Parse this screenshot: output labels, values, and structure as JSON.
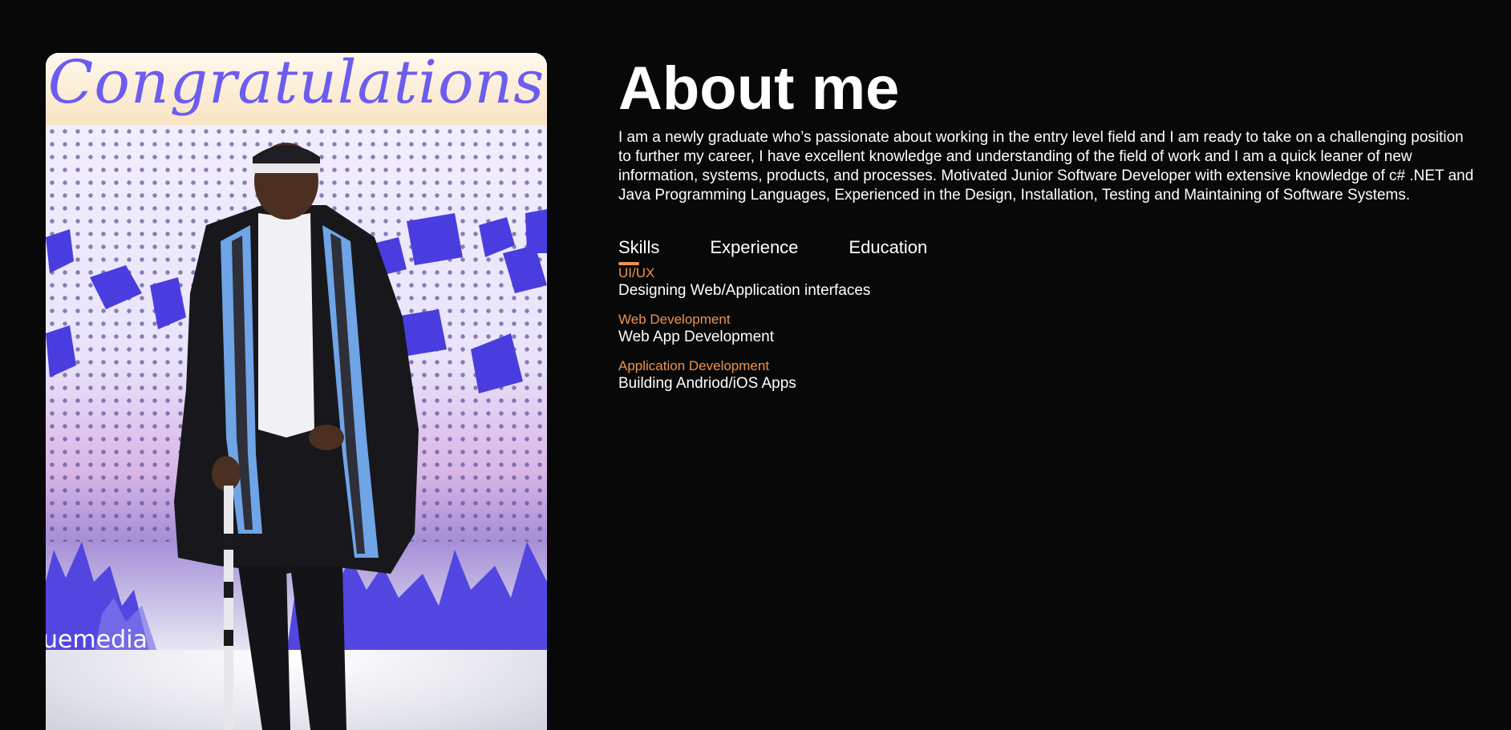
{
  "photo": {
    "banner_text": "Congratulations",
    "brand_text": "uemedia",
    "alt": "Graduation portrait"
  },
  "about": {
    "title": "About me",
    "bio": "I am a newly graduate who’s passionate about working in the entry level field and I am ready to take on a challenging position to further my career, I have excellent knowledge and understanding of the field of work and I am a quick leaner of new information, systems, products, and processes. Motivated Junior Software Developer with extensive knowledge of c# .NET and Java Programming Languages, Experienced in the Design, Installation, Testing and Maintaining of Software Systems."
  },
  "tabs": [
    {
      "label": "Skills",
      "active": true
    },
    {
      "label": "Experience",
      "active": false
    },
    {
      "label": "Education",
      "active": false
    }
  ],
  "skills": [
    {
      "title": "UI/UX",
      "desc": "Designing Web/Application interfaces"
    },
    {
      "title": "Web Development",
      "desc": "Web App Development"
    },
    {
      "title": "Application Development",
      "desc": "Building Andriod/iOS Apps"
    }
  ],
  "colors": {
    "background": "#080808",
    "accent": "#f0924a",
    "text": "#ffffff"
  }
}
